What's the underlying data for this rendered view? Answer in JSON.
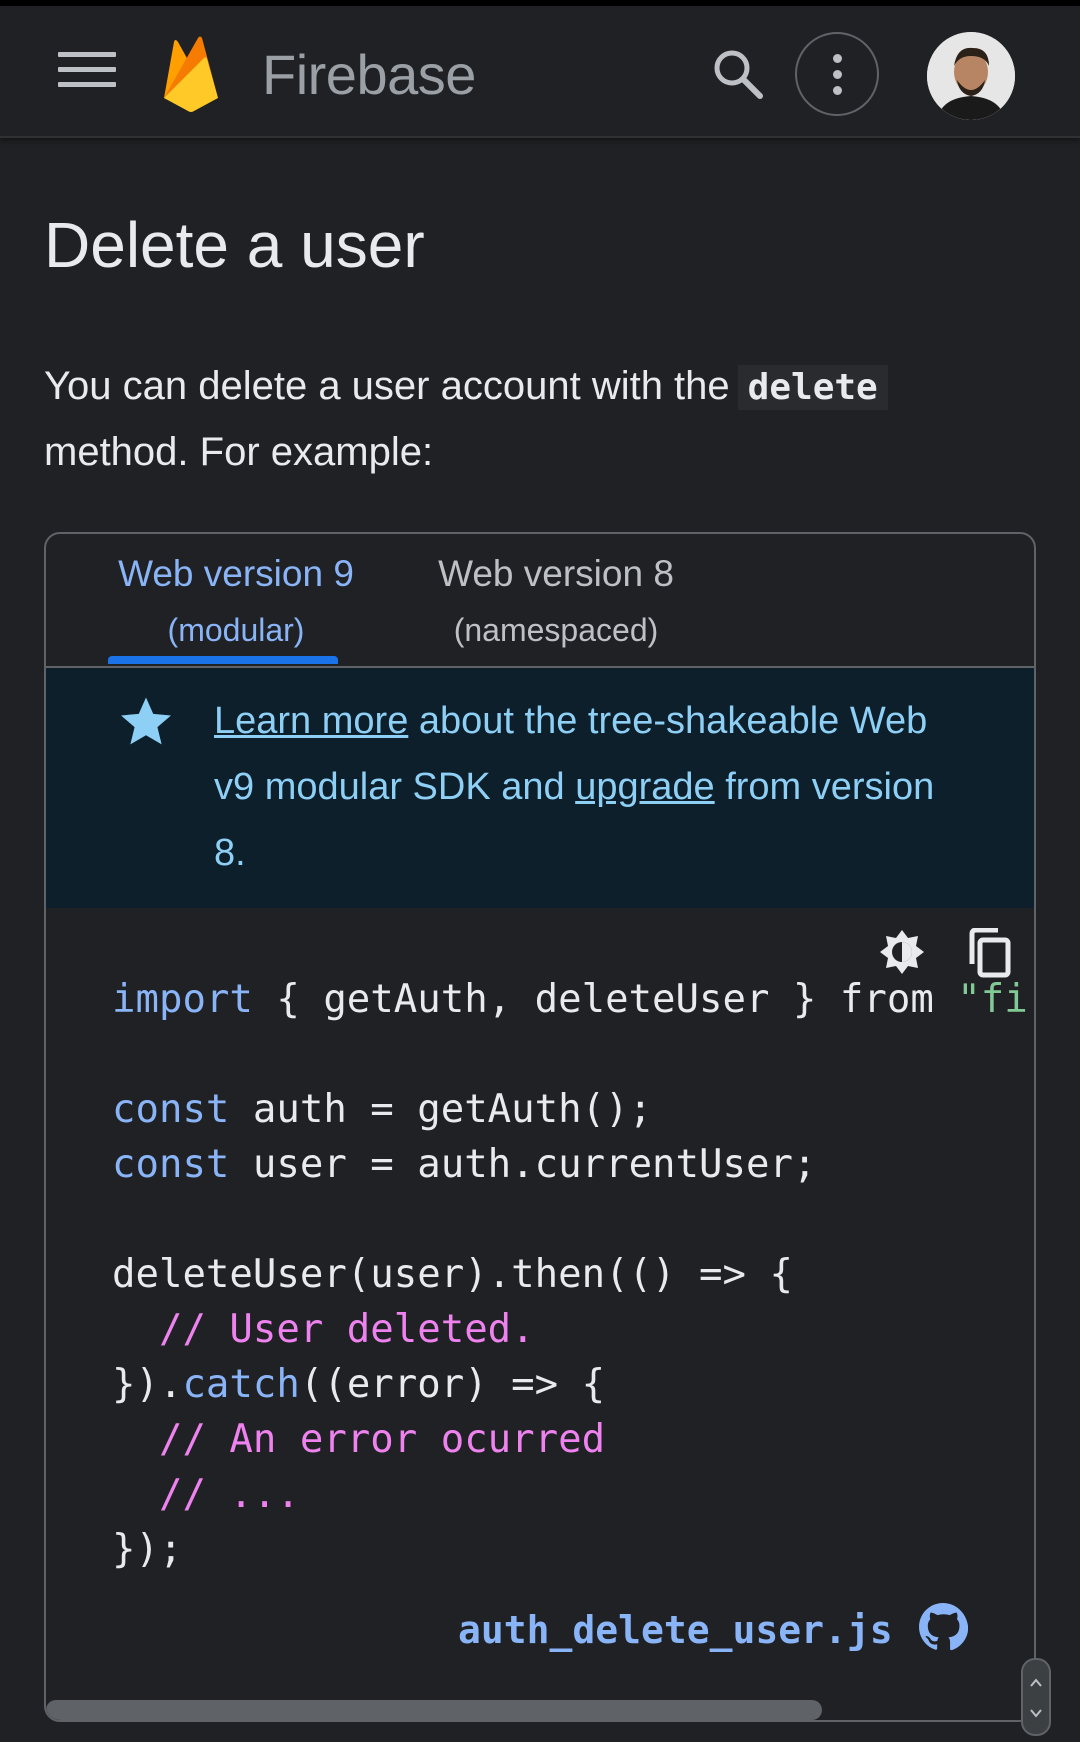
{
  "header": {
    "brand": "Firebase",
    "icons": {
      "menu": "menu-icon",
      "logo": "firebase-logo",
      "search": "search-icon",
      "more": "more-vert-icon",
      "avatar": "user-avatar"
    }
  },
  "page": {
    "title": "Delete a user",
    "intro_before": "You can delete a user account with the",
    "intro_code": "delete",
    "intro_after": "method. For example:"
  },
  "tabs": [
    {
      "label": "Web version 9",
      "sub": "(modular)",
      "active": true
    },
    {
      "label": "Web version 8",
      "sub": "(namespaced)",
      "active": false
    }
  ],
  "notice": {
    "link1": "Learn more",
    "text1": " about the tree-shakeable Web v9 modular SDK and ",
    "link2": "upgrade",
    "text2": " from version 8."
  },
  "code": {
    "line1_kw": "import",
    "line1_rest": " { getAuth, deleteUser } from ",
    "line1_str": "\"fir",
    "line3_kw": "const",
    "line3_rest": " auth = getAuth();",
    "line4_kw": "const",
    "line4_rest": " user = auth.currentUser;",
    "line6": "deleteUser(user).then(() => {",
    "line7": "  // User deleted.",
    "line8a": "}).",
    "line8_kw": "catch",
    "line8b": "((error) => {",
    "line9": "  // An error ocurred",
    "line10": "  // ...",
    "line11": "});"
  },
  "file": {
    "name": "auth_delete_user.js",
    "icon": "github-icon"
  },
  "colors": {
    "accent": "#8ab4f8",
    "indicator": "#1a73e8",
    "comment": "#ee82ee",
    "string": "#81c995",
    "notice_bg": "#0d1f2b"
  }
}
